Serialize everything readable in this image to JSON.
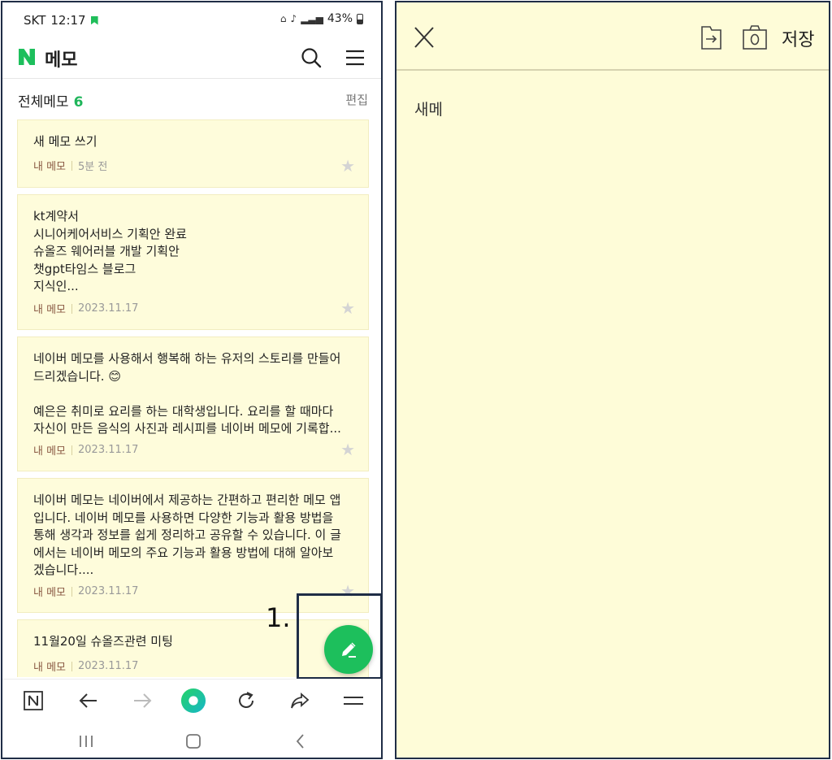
{
  "status": {
    "carrier": "SKT",
    "time": "12:17",
    "battery": "43%"
  },
  "app": {
    "title": "메모"
  },
  "list": {
    "title": "전체메모",
    "count": "6",
    "edit_label": "편집"
  },
  "memos": [
    {
      "body": "새 메모 쓰기",
      "owner": "내 메모",
      "date": "5분 전"
    },
    {
      "body": "kt계약서\n시니어케어서비스 기획안 완료\n슈올즈 웨어러블 개발 기획안\n챗gpt타임스 블로그\n지식인...",
      "owner": "내 메모",
      "date": "2023.11.17"
    },
    {
      "body": "네이버 메모를 사용해서 행복해 하는 유저의 스토리를 만들어\n드리겠습니다. 😊\n\n예은은 취미로 요리를 하는 대학생입니다. 요리를 할 때마다\n자신이 만든 음식의 사진과 레시피를 네이버 메모에 기록합...",
      "owner": "내 메모",
      "date": "2023.11.17"
    },
    {
      "body": "네이버 메모는 네이버에서 제공하는 간편하고 편리한 메모 앱\n입니다. 네이버 메모를 사용하면 다양한 기능과 활용 방법을\n통해 생각과 정보를 쉽게 정리하고 공유할 수 있습니다. 이 글\n에서는 네이버 메모의 주요 기능과 활용 방법에 대해 알아보\n겠습니다....",
      "owner": "내 메모",
      "date": "2023.11.17"
    },
    {
      "body": "11월20일 슈올즈관련 미팅",
      "owner": "내 메모",
      "date": "2023.11.17"
    }
  ],
  "annotation": {
    "step": "1."
  },
  "editor": {
    "save_label": "저장",
    "text": "새메"
  },
  "colors": {
    "brand_green": "#1dbf5c",
    "memo_bg": "#fefcdb",
    "owner_text": "#8a5a44",
    "frame": "#1f2d46"
  },
  "icons": [
    "naver-n-icon",
    "search-icon",
    "hamburger-menu-icon",
    "star-icon",
    "pencil-icon",
    "close-icon",
    "export-icon",
    "camera-icon",
    "back-arrow-icon",
    "forward-arrow-icon",
    "refresh-icon",
    "share-icon"
  ]
}
